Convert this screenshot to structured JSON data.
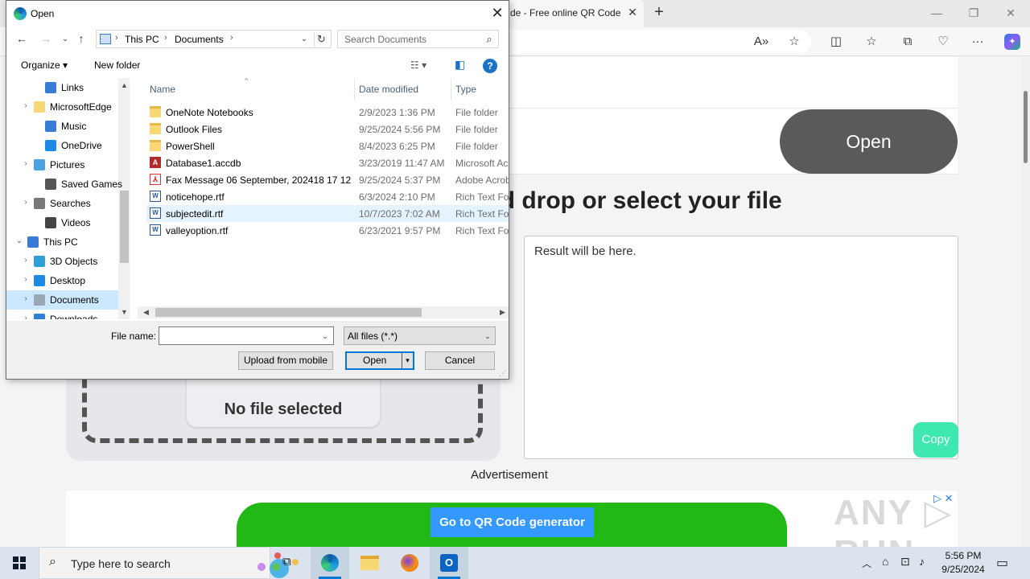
{
  "browser": {
    "tab_title": "de - Free online QR Code re",
    "tab_close": "✕",
    "new_tab": "+",
    "win_min": "—",
    "win_restore": "❐",
    "win_close": "✕",
    "toolbar_icons": [
      "read-aloud-icon",
      "star-icon",
      "split-screen-icon",
      "favorites-icon",
      "collections-icon",
      "performance-icon",
      "more-icon",
      "copilot-icon"
    ]
  },
  "page": {
    "open_button": "Open",
    "heading": "g and drop or select your file",
    "result_placeholder": "Result will be here.",
    "copy_button": "Copy",
    "no_file": "No file selected",
    "advertisement": "Advertisement",
    "ad_button": "Go to QR Code generator",
    "ad_choice": "▷ ✕",
    "watermark": "ANY ▷ RUN"
  },
  "dialog": {
    "title": "Open",
    "close": "✕",
    "path": [
      "This PC",
      "Documents"
    ],
    "search_placeholder": "Search Documents",
    "organize": "Organize ▾",
    "new_folder": "New folder",
    "help": "?",
    "nav_items": [
      {
        "label": "Links",
        "expander": "",
        "icon_color": "#3a7bd5"
      },
      {
        "label": "MicrosoftEdge",
        "expander": "›",
        "icon_color": "#f8d775"
      },
      {
        "label": "Music",
        "expander": "",
        "icon_color": "#3a7bd5"
      },
      {
        "label": "OneDrive",
        "expander": "",
        "icon_color": "#1e88e5"
      },
      {
        "label": "Pictures",
        "expander": "›",
        "icon_color": "#4aa3df"
      },
      {
        "label": "Saved Games",
        "expander": "",
        "icon_color": "#555555"
      },
      {
        "label": "Searches",
        "expander": "›",
        "icon_color": "#777777"
      },
      {
        "label": "Videos",
        "expander": "",
        "icon_color": "#444444"
      },
      {
        "label": "This PC",
        "expander": "⌄",
        "icon_color": "#3a7bd5"
      },
      {
        "label": "3D Objects",
        "expander": "›",
        "icon_color": "#2f9fd6"
      },
      {
        "label": "Desktop",
        "expander": "›",
        "icon_color": "#1e88e5"
      },
      {
        "label": "Documents",
        "expander": "›",
        "icon_color": "#9aa7b5"
      },
      {
        "label": "Downloads",
        "expander": "›",
        "icon_color": "#2f7fd6"
      }
    ],
    "columns": {
      "name": "Name",
      "date": "Date modified",
      "type": "Type"
    },
    "files": [
      {
        "name": "OneNote Notebooks",
        "date": "2/9/2023 1:36 PM",
        "type": "File folder",
        "icon": "folder-icon",
        "glyph": ""
      },
      {
        "name": "Outlook Files",
        "date": "9/25/2024 5:56 PM",
        "type": "File folder",
        "icon": "folder-icon",
        "glyph": ""
      },
      {
        "name": "PowerShell",
        "date": "8/4/2023 6:25 PM",
        "type": "File folder",
        "icon": "folder-icon",
        "glyph": ""
      },
      {
        "name": "Database1.accdb",
        "date": "3/23/2019 11:47 AM",
        "type": "Microsoft Ac",
        "icon": "access-file-icon",
        "glyph": "A"
      },
      {
        "name": "Fax Message 06 September, 202418 17 12 ...",
        "date": "9/25/2024 5:37 PM",
        "type": "Adobe Acrob",
        "icon": "pdf-file-icon",
        "glyph": "⅄"
      },
      {
        "name": "noticehope.rtf",
        "date": "6/3/2024 2:10 PM",
        "type": "Rich Text For",
        "icon": "rtf-file-icon",
        "glyph": "W"
      },
      {
        "name": "subjectedit.rtf",
        "date": "10/7/2023 7:02 AM",
        "type": "Rich Text For",
        "icon": "rtf-file-icon",
        "glyph": "W"
      },
      {
        "name": "valleyoption.rtf",
        "date": "6/23/2021 9:57 PM",
        "type": "Rich Text For",
        "icon": "rtf-file-icon",
        "glyph": "W"
      }
    ],
    "file_name_label": "File name:",
    "file_name_value": "",
    "filter": "All files (*.*)",
    "upload_mobile": "Upload from mobile",
    "open_btn": "Open",
    "cancel_btn": "Cancel"
  },
  "taskbar": {
    "search_text": "Type here to search",
    "apps": [
      "task-view-icon",
      "edge-icon",
      "file-explorer-icon",
      "firefox-icon",
      "outlook-icon"
    ],
    "time": "5:56 PM",
    "date": "9/25/2024"
  }
}
